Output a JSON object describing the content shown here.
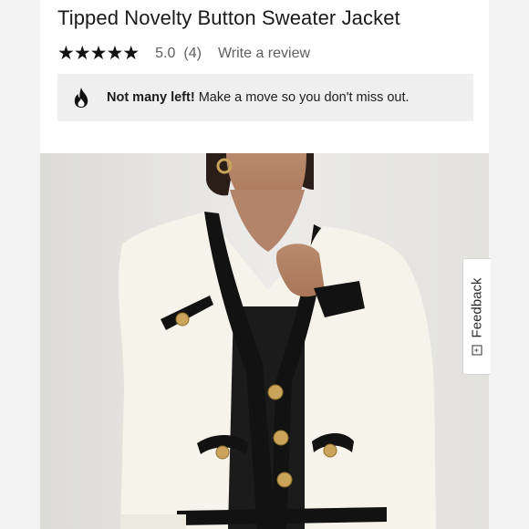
{
  "product": {
    "title": "Tipped Novelty Button Sweater Jacket",
    "rating": {
      "stars_filled": 5,
      "stars_total": 5,
      "stars_glyphs": "★★★★★",
      "value": "5.0",
      "count": "(4)",
      "write_review_label": "Write a review"
    }
  },
  "alert": {
    "icon": "fire-icon",
    "bold_text": "Not many left!",
    "text": " Make a move so you don't miss out."
  },
  "image": {
    "description_icon": "product-photo"
  },
  "feedback": {
    "icon_glyph": "+",
    "label": "Feedback"
  },
  "colors": {
    "alert_background": "#efefef",
    "page_background": "#ffffff",
    "sweater_cream": "#f6f3ea",
    "trim_black": "#121212",
    "button_gold": "#c9a45a"
  }
}
